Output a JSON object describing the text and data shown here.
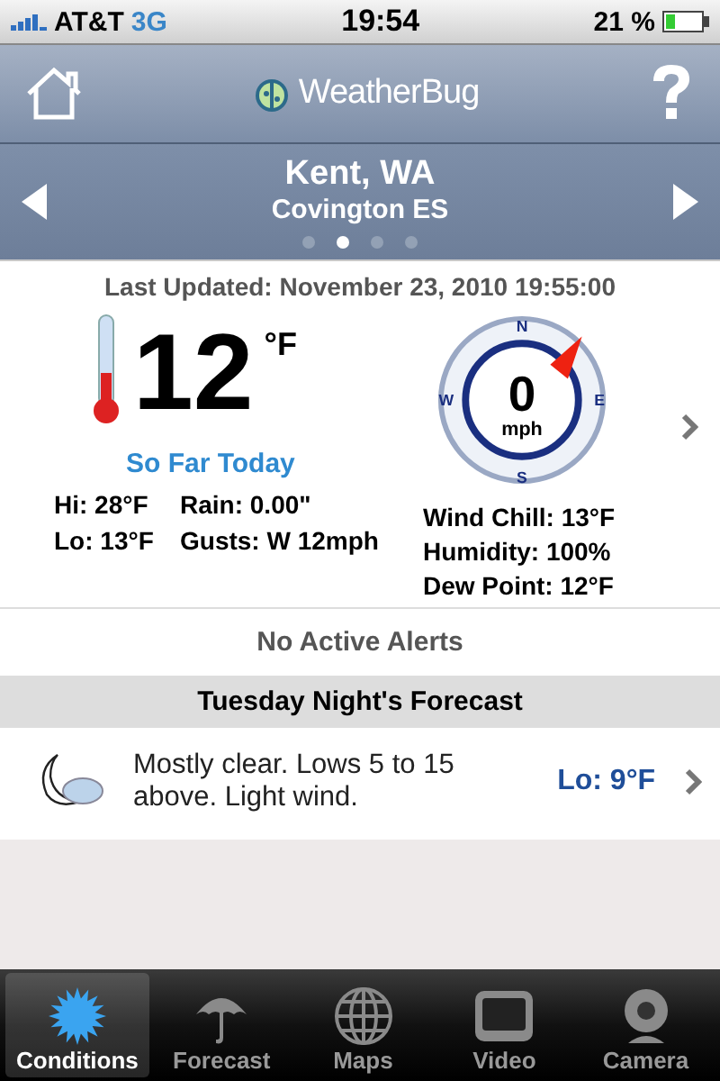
{
  "status_bar": {
    "carrier": "AT&T",
    "network": "3G",
    "time": "19:54",
    "battery": "21 %"
  },
  "header": {
    "logo": "WeatherBug"
  },
  "location": {
    "city": "Kent, WA",
    "station": "Covington ES",
    "pages": [
      {
        "selected": false
      },
      {
        "selected": true
      },
      {
        "selected": false
      },
      {
        "selected": false
      }
    ]
  },
  "conditions": {
    "last_updated": "Last Updated: November 23, 2010 19:55:00",
    "temperature": "12",
    "unit": "°F",
    "wind": {
      "speed": "0",
      "unit": "mph",
      "north": "N",
      "east": "E",
      "south": "S",
      "west": "W"
    },
    "so_far_today": "So Far Today",
    "today_stats": [
      [
        "Hi: 28°F",
        "Rain: 0.00\""
      ],
      [
        "Lo: 13°F",
        "Gusts: W 12mph"
      ]
    ],
    "details": [
      "Wind Chill: 13°F",
      "Humidity: 100%",
      "Dew Point: 12°F"
    ]
  },
  "alerts": "No Active Alerts",
  "forecast": {
    "title": "Tuesday Night's Forecast",
    "text": "Mostly clear. Lows 5 to 15 above. Light wind.",
    "low": "Lo: 9°F"
  },
  "tabs": [
    {
      "label": "Conditions",
      "kind": "sun",
      "selected": true
    },
    {
      "label": "Forecast",
      "kind": "umbrella",
      "selected": false
    },
    {
      "label": "Maps",
      "kind": "globe",
      "selected": false
    },
    {
      "label": "Video",
      "kind": "tv",
      "selected": false
    },
    {
      "label": "Camera",
      "kind": "webcam",
      "selected": false
    }
  ]
}
